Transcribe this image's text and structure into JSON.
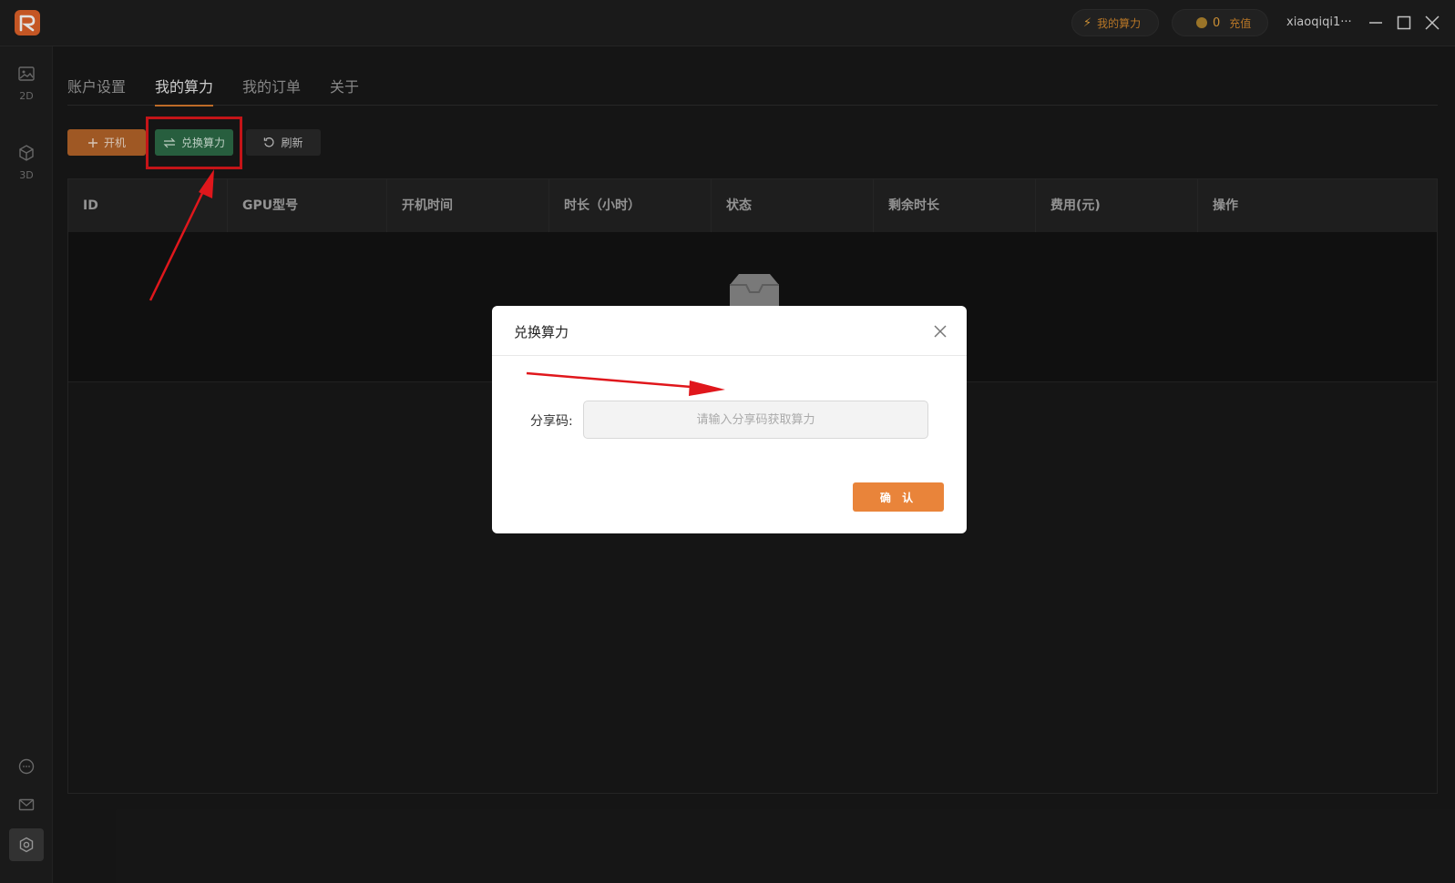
{
  "topbar": {
    "compute_label": "我的算力",
    "coin_count": "0",
    "recharge_label": "充值",
    "username": "xiaoqiqi1···"
  },
  "sidebar": {
    "item_2d": "2D",
    "item_3d": "3D"
  },
  "tabs": [
    {
      "label": "账户设置"
    },
    {
      "label": "我的算力"
    },
    {
      "label": "我的订单"
    },
    {
      "label": "关于"
    }
  ],
  "toolbar": {
    "start_label": "开机",
    "exchange_label": "兑换算力",
    "refresh_label": "刷新"
  },
  "table": {
    "columns": [
      "ID",
      "GPU型号",
      "开机时间",
      "时长（小时）",
      "状态",
      "剩余时长",
      "费用(元)",
      "操作"
    ]
  },
  "dialog": {
    "title": "兑换算力",
    "field_label": "分享码:",
    "placeholder": "请输入分享码获取算力",
    "value": "",
    "confirm_label": "确 认"
  },
  "colors": {
    "accent": "#e9843a",
    "exchange_button": "#2d6b47",
    "annotation_red": "#e0171c"
  }
}
